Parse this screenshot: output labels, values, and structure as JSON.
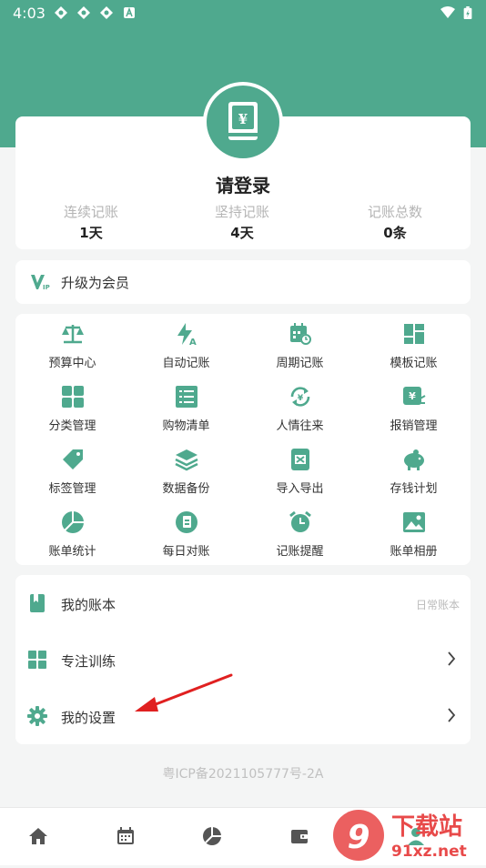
{
  "status_bar": {
    "time": "4:03"
  },
  "profile": {
    "login_prompt": "请登录",
    "stats": [
      {
        "label": "连续记账",
        "value": "1天"
      },
      {
        "label": "坚持记账",
        "value": "4天"
      },
      {
        "label": "记账总数",
        "value": "0条"
      }
    ]
  },
  "vip": {
    "badge": "VIP",
    "label": "升级为会员"
  },
  "features": [
    {
      "label": "预算中心",
      "icon": "scale-icon"
    },
    {
      "label": "自动记账",
      "icon": "bolt-a-icon"
    },
    {
      "label": "周期记账",
      "icon": "calendar-cycle-icon"
    },
    {
      "label": "模板记账",
      "icon": "template-icon"
    },
    {
      "label": "分类管理",
      "icon": "category-icon"
    },
    {
      "label": "购物清单",
      "icon": "list-icon"
    },
    {
      "label": "人情往来",
      "icon": "exchange-icon"
    },
    {
      "label": "报销管理",
      "icon": "reimburse-icon"
    },
    {
      "label": "标签管理",
      "icon": "tag-icon"
    },
    {
      "label": "数据备份",
      "icon": "layers-icon"
    },
    {
      "label": "导入导出",
      "icon": "excel-icon"
    },
    {
      "label": "存钱计划",
      "icon": "piggy-bank-icon"
    },
    {
      "label": "账单统计",
      "icon": "pie-chart-icon"
    },
    {
      "label": "每日对账",
      "icon": "daily-check-icon"
    },
    {
      "label": "记账提醒",
      "icon": "alarm-icon"
    },
    {
      "label": "账单相册",
      "icon": "photo-icon"
    }
  ],
  "settings_list": {
    "my_book": {
      "label": "我的账本",
      "value": "日常账本"
    },
    "focus_training": {
      "label": "专注训练"
    },
    "my_settings": {
      "label": "我的设置"
    }
  },
  "icp": "粤ICP备2021105777号-2A",
  "watermark": {
    "text1": "下载站",
    "text2": "91xz.net"
  },
  "colors": {
    "accent": "#4fa98e",
    "arrow": "#e02020"
  }
}
